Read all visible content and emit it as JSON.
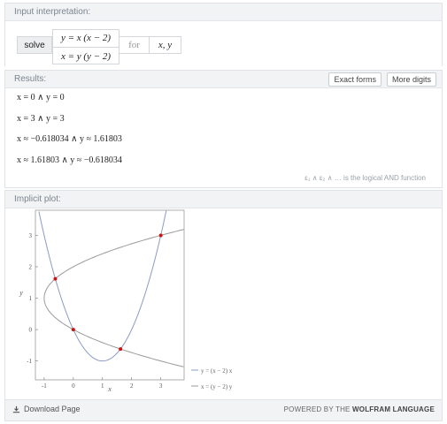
{
  "input": {
    "header": "Input interpretation:",
    "solve": "solve",
    "eq1": "y = x (x − 2)",
    "eq2": "x = y (y − 2)",
    "for": "for",
    "vars": "x, y"
  },
  "results": {
    "header": "Results:",
    "exact_forms": "Exact forms",
    "more_digits": "More digits",
    "items": [
      "x = 0 ∧ y = 0",
      "x = 3 ∧ y = 3",
      "x ≈ −0.618034 ∧ y ≈ 1.61803",
      "x ≈ 1.61803 ∧ y ≈ −0.618034"
    ],
    "footnote": "ε₁ ∧ ε₂ ∧ … is the logical AND function"
  },
  "plot": {
    "header": "Implicit plot:",
    "xlabel": "x",
    "ylabel": "y",
    "xticks": [
      "-1",
      "0",
      "1",
      "2",
      "3"
    ],
    "yticks": [
      "3",
      "2",
      "1",
      "0",
      "-1"
    ],
    "legend1": "y = (x − 2) x",
    "legend2": "x = (y − 2) y",
    "curve_color": "#8a9cc4",
    "curve2_color": "#9a9a9a",
    "point_color": "#cc1111"
  },
  "chart_data": {
    "type": "line",
    "xlabel": "x",
    "ylabel": "y",
    "xlim": [
      -1.3,
      3.8
    ],
    "ylim": [
      -1.6,
      3.8
    ],
    "series": [
      {
        "name": "y = (x − 2) x",
        "equation": "y = x(x-2)"
      },
      {
        "name": "x = (y − 2) y",
        "equation": "x = y(y-2)"
      }
    ],
    "points": [
      {
        "x": 0,
        "y": 0
      },
      {
        "x": 3,
        "y": 3
      },
      {
        "x": -0.618034,
        "y": 1.61803
      },
      {
        "x": 1.61803,
        "y": -0.618034
      }
    ]
  },
  "footer": {
    "download": "Download Page",
    "powered_prefix": "POWERED BY THE",
    "powered_brand": "WOLFRAM LANGUAGE"
  }
}
